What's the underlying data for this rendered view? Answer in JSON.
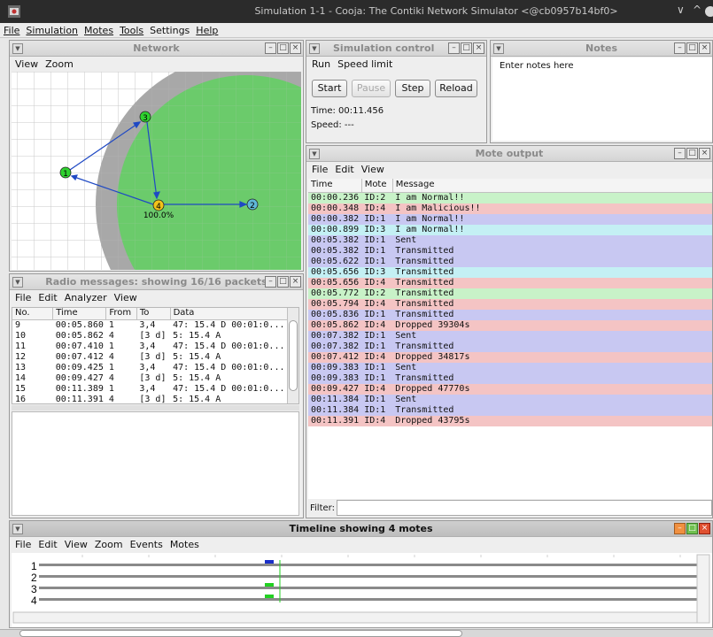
{
  "window": {
    "title": "Simulation 1-1 - Cooja: The Contiki Network Simulator <@cb0957b14bf0>",
    "controls": [
      "∨",
      "^"
    ]
  },
  "menubar": [
    "File",
    "Simulation",
    "Motes",
    "Tools",
    "Settings",
    "Help"
  ],
  "network": {
    "title": "Network",
    "menu": [
      "View",
      "Zoom"
    ],
    "motes": [
      {
        "id": "1",
        "color": "#2fd12f"
      },
      {
        "id": "2",
        "color": "#5fb8d8"
      },
      {
        "id": "3",
        "color": "#2fd12f"
      },
      {
        "id": "4",
        "color": "#f2c21a"
      }
    ],
    "range_label": "100.0%",
    "colors": {
      "rx_range": "#6bcb6b",
      "interference": "#a8a8a8",
      "link": "#1f49c4"
    }
  },
  "simulation_control": {
    "title": "Simulation control",
    "menu": [
      "Run",
      "Speed limit"
    ],
    "buttons": {
      "start": "Start",
      "pause": "Pause",
      "step": "Step",
      "reload": "Reload"
    },
    "time": "Time: 00:11.456",
    "speed": "Speed: ---"
  },
  "notes": {
    "title": "Notes",
    "text": "Enter notes here"
  },
  "mote_output": {
    "title": "Mote output",
    "menu": [
      "File",
      "Edit",
      "View"
    ],
    "columns": [
      "Time",
      "Mote",
      "Message"
    ],
    "rows": [
      {
        "time": "00:00.236",
        "mote": "ID:2",
        "message": "I am Normal!!",
        "color": "#c8f2c8"
      },
      {
        "time": "00:00.348",
        "mote": "ID:4",
        "message": "I am Malicious!!",
        "color": "#f4c4c4"
      },
      {
        "time": "00:00.382",
        "mote": "ID:1",
        "message": "I am Normal!!",
        "color": "#c8c8f2"
      },
      {
        "time": "00:00.899",
        "mote": "ID:3",
        "message": "I am Normal!!",
        "color": "#c4f0f4"
      },
      {
        "time": "00:05.382",
        "mote": "ID:1",
        "message": "Sent",
        "color": "#c8c8f2"
      },
      {
        "time": "00:05.382",
        "mote": "ID:1",
        "message": "Transmitted",
        "color": "#c8c8f2"
      },
      {
        "time": "00:05.622",
        "mote": "ID:1",
        "message": "Transmitted",
        "color": "#c8c8f2"
      },
      {
        "time": "00:05.656",
        "mote": "ID:3",
        "message": "Transmitted",
        "color": "#c4f0f4"
      },
      {
        "time": "00:05.656",
        "mote": "ID:4",
        "message": "Transmitted",
        "color": "#f4c4c4"
      },
      {
        "time": "00:05.772",
        "mote": "ID:2",
        "message": "Transmitted",
        "color": "#c8f2c8"
      },
      {
        "time": "00:05.794",
        "mote": "ID:4",
        "message": "Transmitted",
        "color": "#f4c4c4"
      },
      {
        "time": "00:05.836",
        "mote": "ID:1",
        "message": "Transmitted",
        "color": "#c8c8f2"
      },
      {
        "time": "00:05.862",
        "mote": "ID:4",
        "message": "Dropped 39304s",
        "color": "#f4c4c4"
      },
      {
        "time": "00:07.382",
        "mote": "ID:1",
        "message": "Sent",
        "color": "#c8c8f2"
      },
      {
        "time": "00:07.382",
        "mote": "ID:1",
        "message": "Transmitted",
        "color": "#c8c8f2"
      },
      {
        "time": "00:07.412",
        "mote": "ID:4",
        "message": "Dropped 34817s",
        "color": "#f4c4c4"
      },
      {
        "time": "00:09.383",
        "mote": "ID:1",
        "message": "Sent",
        "color": "#c8c8f2"
      },
      {
        "time": "00:09.383",
        "mote": "ID:1",
        "message": "Transmitted",
        "color": "#c8c8f2"
      },
      {
        "time": "00:09.427",
        "mote": "ID:4",
        "message": "Dropped 47770s",
        "color": "#f4c4c4"
      },
      {
        "time": "00:11.384",
        "mote": "ID:1",
        "message": "Sent",
        "color": "#c8c8f2"
      },
      {
        "time": "00:11.384",
        "mote": "ID:1",
        "message": "Transmitted",
        "color": "#c8c8f2"
      },
      {
        "time": "00:11.391",
        "mote": "ID:4",
        "message": "Dropped 43795s",
        "color": "#f4c4c4"
      }
    ],
    "filter_label": "Filter:"
  },
  "radio": {
    "title": "Radio messages: showing 16/16 packets",
    "menu": [
      "File",
      "Edit",
      "Analyzer",
      "View"
    ],
    "columns": [
      "No.",
      "Time",
      "From",
      "To",
      "Data"
    ],
    "rows": [
      [
        "9",
        "00:05.860",
        "1",
        "3,4",
        "47: 15.4 D 00:01:0..."
      ],
      [
        "10",
        "00:05.862",
        "4",
        "[3 d]",
        "5: 15.4 A"
      ],
      [
        "11",
        "00:07.410",
        "1",
        "3,4",
        "47: 15.4 D 00:01:0..."
      ],
      [
        "12",
        "00:07.412",
        "4",
        "[3 d]",
        "5: 15.4 A"
      ],
      [
        "13",
        "00:09.425",
        "1",
        "3,4",
        "47: 15.4 D 00:01:0..."
      ],
      [
        "14",
        "00:09.427",
        "4",
        "[3 d]",
        "5: 15.4 A"
      ],
      [
        "15",
        "00:11.389",
        "1",
        "3,4",
        "47: 15.4 D 00:01:0..."
      ],
      [
        "16",
        "00:11.391",
        "4",
        "[3 d]",
        "5: 15.4 A"
      ]
    ]
  },
  "timeline": {
    "title": "Timeline showing 4 motes",
    "menu": [
      "File",
      "Edit",
      "View",
      "Zoom",
      "Events",
      "Motes"
    ],
    "motes": [
      "1",
      "2",
      "3",
      "4"
    ],
    "colors": {
      "tx": "#1a2fc8",
      "rx": "#22d022"
    }
  }
}
